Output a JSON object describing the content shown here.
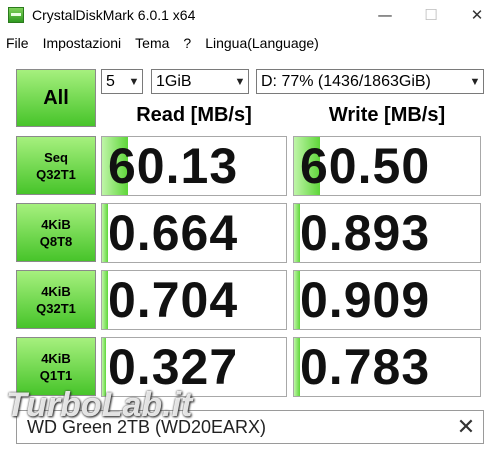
{
  "window": {
    "title": "CrystalDiskMark 6.0.1 x64",
    "minimize": "—",
    "maximize": "☐",
    "close": "✕"
  },
  "menu": [
    {
      "label": "File"
    },
    {
      "label": "Impostazioni"
    },
    {
      "label": "Tema"
    },
    {
      "label": "?"
    },
    {
      "label": "Lingua(Language)"
    }
  ],
  "controls": {
    "all_label": "All",
    "count": "5",
    "size": "1GiB",
    "drive": "D: 77% (1436/1863GiB)"
  },
  "headers": {
    "read": "Read [MB/s]",
    "write": "Write [MB/s]"
  },
  "tests": [
    {
      "line1": "Seq",
      "line2": "Q32T1",
      "read": "60.13",
      "write": "60.50",
      "read_fill": 0.14,
      "write_fill": 0.14
    },
    {
      "line1": "4KiB",
      "line2": "Q8T8",
      "read": "0.664",
      "write": "0.893",
      "read_fill": 0.03,
      "write_fill": 0.03
    },
    {
      "line1": "4KiB",
      "line2": "Q32T1",
      "read": "0.704",
      "write": "0.909",
      "read_fill": 0.03,
      "write_fill": 0.03
    },
    {
      "line1": "4KiB",
      "line2": "Q1T1",
      "read": "0.327",
      "write": "0.783",
      "read_fill": 0.02,
      "write_fill": 0.03
    }
  ],
  "comment": {
    "text": "WD Green 2TB (WD20EARX)",
    "clear": "✕"
  },
  "watermark": "TurboLab.it",
  "colors": {
    "button_top": "#a6f07e",
    "button_bottom": "#47c42a",
    "bar_light": "#bff5a8",
    "bar_dark": "#5fd63a"
  }
}
